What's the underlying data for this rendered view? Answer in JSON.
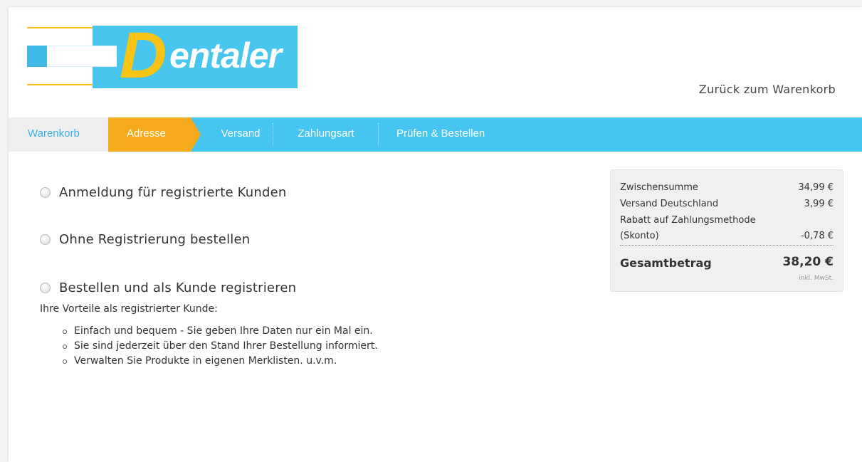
{
  "brand": {
    "logo_text_initial": "D",
    "logo_text_rest": "entaler",
    "colors": {
      "cyan": "#49c6ee",
      "yellow": "#f7c415",
      "orange": "#f5a91c"
    }
  },
  "header": {
    "back_link": "Zurück zum Warenkorb"
  },
  "steps": {
    "cart": "Warenkorb",
    "address": "Adresse",
    "shipping": "Versand",
    "payment": "Zahlungsart",
    "review": "Prüfen & Bestellen",
    "active": "Adresse"
  },
  "options": [
    {
      "label": "Anmeldung für registrierte Kunden",
      "selected": false
    },
    {
      "label": "Ohne Registrierung bestellen",
      "selected": false
    },
    {
      "label": "Bestellen und als Kunde registrieren",
      "selected": false
    }
  ],
  "benefits": {
    "title": "Ihre Vorteile als registrierter Kunde:",
    "items": [
      "Einfach und bequem - Sie geben Ihre Daten nur ein Mal ein.",
      "Sie sind jederzeit über den Stand Ihrer Bestellung informiert.",
      "Verwalten Sie Produkte in eigenen Merklisten. u.v.m."
    ]
  },
  "summary": {
    "subtotal_label": "Zwischensumme",
    "subtotal_value": "34,99 €",
    "shipping_label": "Versand Deutschland",
    "shipping_value": "3,99 €",
    "discount_label_line1": "Rabatt auf Zahlungsmethode",
    "discount_label_line2": "(Skonto)",
    "discount_value": "-0,78 €",
    "total_label": "Gesamtbetrag",
    "total_value": "38,20 €",
    "tax_note": "inkl. MwSt."
  }
}
